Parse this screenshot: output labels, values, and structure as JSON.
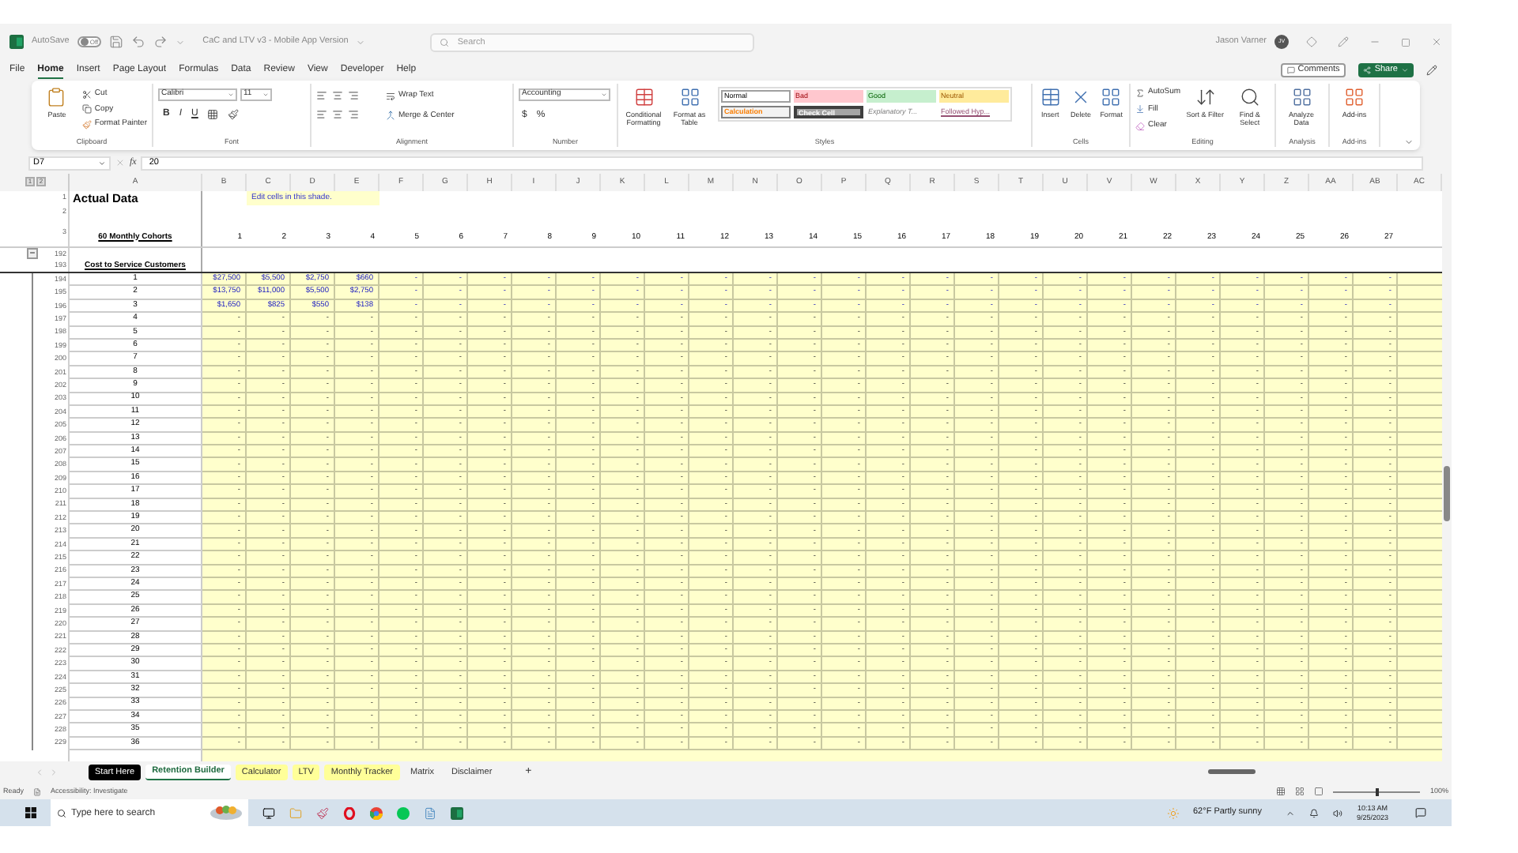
{
  "title_bar": {
    "autosave_label": "AutoSave",
    "autosave": {
      "on": false,
      "label": "Off"
    },
    "document_title": "CaC and LTV v3 - Mobile App Version",
    "search_placeholder": "Search",
    "user_name": "Jason Varner",
    "avatar_initials": "JV"
  },
  "menu_tabs": [
    {
      "label": "File",
      "selected": false
    },
    {
      "label": "Home",
      "selected": true
    },
    {
      "label": "Insert",
      "selected": false
    },
    {
      "label": "Page Layout",
      "selected": false
    },
    {
      "label": "Formulas",
      "selected": false
    },
    {
      "label": "Data",
      "selected": false
    },
    {
      "label": "Review",
      "selected": false
    },
    {
      "label": "View",
      "selected": false
    },
    {
      "label": "Developer",
      "selected": false
    },
    {
      "label": "Help",
      "selected": false
    }
  ],
  "comments_button": "Comments",
  "share_button": "Share",
  "ribbon": {
    "clipboard": {
      "paste": "Paste",
      "cut": "Cut",
      "copy": "Copy",
      "format_painter": "Format Painter",
      "group_label": "Clipboard"
    },
    "font": {
      "font_name": "Calibri",
      "font_size": "11",
      "format_buttons": [
        "B",
        "I",
        "U"
      ],
      "group_label": "Font"
    },
    "alignment": {
      "wrap_text": "Wrap Text",
      "merge_center": "Merge & Center",
      "group_label": "Alignment"
    },
    "number": {
      "format": "Accounting",
      "symbols": [
        "$",
        "%"
      ],
      "group_label": "Number"
    },
    "styles": {
      "conditional_formatting": "Conditional Formatting",
      "format_as_table": "Format as Table",
      "group_label": "Styles",
      "cell_styles": [
        {
          "label": "Normal",
          "kind": "normal"
        },
        {
          "label": "Bad",
          "kind": "bad"
        },
        {
          "label": "Good",
          "kind": "good"
        },
        {
          "label": "Neutral",
          "kind": "neutral"
        },
        {
          "label": "Calculation",
          "kind": "calculation"
        },
        {
          "label": "Check Cell",
          "kind": "check"
        },
        {
          "label": "Explanatory T...",
          "kind": "explanatory"
        },
        {
          "label": "Followed Hyp...",
          "kind": "followed"
        }
      ]
    },
    "cells": {
      "buttons": [
        "Insert",
        "Delete",
        "Format"
      ],
      "group_label": "Cells"
    },
    "editing": {
      "autosum": "AutoSum",
      "fill": "Fill",
      "clear": "Clear",
      "sort_filter": "Sort & Filter",
      "find_select": "Find & Select",
      "group_label": "Editing"
    },
    "analysis": {
      "analyze_data": "Analyze Data",
      "group_label": "Analysis"
    },
    "add_ins": {
      "button": "Add-ins",
      "group_label": "Add-ins"
    }
  },
  "formula_bar": {
    "name_box": "D7",
    "fx": "fx",
    "value": "20"
  },
  "sheet": {
    "outline_levels": [
      "1",
      "2"
    ],
    "collapse_button": "−",
    "columns": [
      "A",
      "B",
      "C",
      "D",
      "E",
      "F",
      "G",
      "H",
      "I",
      "J",
      "K",
      "L",
      "M",
      "N",
      "O",
      "P",
      "Q",
      "R",
      "S",
      "T",
      "U",
      "V",
      "W",
      "X",
      "Y",
      "Z",
      "AA",
      "AB",
      "AC"
    ],
    "title_row": {
      "number": "1",
      "title": "Actual Data",
      "note": "Edit cells in this shade."
    },
    "blank_row": {
      "number": "2"
    },
    "header_row": {
      "number": "3",
      "label": "60 Monthly Cohorts",
      "cells": [
        "1",
        "2",
        "3",
        "4",
        "5",
        "6",
        "7",
        "8",
        "9",
        "10",
        "11",
        "12",
        "13",
        "14",
        "15",
        "16",
        "17",
        "18",
        "19",
        "20",
        "21",
        "22",
        "23",
        "24",
        "25",
        "26",
        "27"
      ]
    },
    "spacer_row": {
      "number": "192"
    },
    "section_row": {
      "number": "193",
      "label": "Cost to Service Customers"
    },
    "rows": [
      {
        "number": "194",
        "label": "1",
        "cells": [
          "$27,500",
          "$5,500",
          "$2,750",
          "$660",
          "-",
          "-",
          "-",
          "-",
          "-",
          "-",
          "-",
          "-",
          "-",
          "-",
          "-",
          "-",
          "-",
          "-",
          "-",
          "-",
          "-",
          "-",
          "-",
          "-",
          "-",
          "-",
          "-"
        ]
      },
      {
        "number": "195",
        "label": "2",
        "cells": [
          "$13,750",
          "$11,000",
          "$5,500",
          "$2,750",
          "-",
          "-",
          "-",
          "-",
          "-",
          "-",
          "-",
          "-",
          "-",
          "-",
          "-",
          "-",
          "-",
          "-",
          "-",
          "-",
          "-",
          "-",
          "-",
          "-",
          "-",
          "-",
          "-"
        ]
      },
      {
        "number": "196",
        "label": "3",
        "cells": [
          "$1,650",
          "$825",
          "$550",
          "$138",
          "-",
          "-",
          "-",
          "-",
          "-",
          "-",
          "-",
          "-",
          "-",
          "-",
          "-",
          "-",
          "-",
          "-",
          "-",
          "-",
          "-",
          "-",
          "-",
          "-",
          "-",
          "-",
          "-"
        ]
      },
      {
        "number": "197",
        "label": "4",
        "cells": [
          "-",
          "-",
          "-",
          "-",
          "-",
          "-",
          "-",
          "-",
          "-",
          "-",
          "-",
          "-",
          "-",
          "-",
          "-",
          "-",
          "-",
          "-",
          "-",
          "-",
          "-",
          "-",
          "-",
          "-",
          "-",
          "-",
          "-"
        ]
      },
      {
        "number": "198",
        "label": "5",
        "cells": [
          "-",
          "-",
          "-",
          "-",
          "-",
          "-",
          "-",
          "-",
          "-",
          "-",
          "-",
          "-",
          "-",
          "-",
          "-",
          "-",
          "-",
          "-",
          "-",
          "-",
          "-",
          "-",
          "-",
          "-",
          "-",
          "-",
          "-"
        ]
      },
      {
        "number": "199",
        "label": "6",
        "cells": [
          "-",
          "-",
          "-",
          "-",
          "-",
          "-",
          "-",
          "-",
          "-",
          "-",
          "-",
          "-",
          "-",
          "-",
          "-",
          "-",
          "-",
          "-",
          "-",
          "-",
          "-",
          "-",
          "-",
          "-",
          "-",
          "-",
          "-"
        ]
      },
      {
        "number": "200",
        "label": "7",
        "cells": [
          "-",
          "-",
          "-",
          "-",
          "-",
          "-",
          "-",
          "-",
          "-",
          "-",
          "-",
          "-",
          "-",
          "-",
          "-",
          "-",
          "-",
          "-",
          "-",
          "-",
          "-",
          "-",
          "-",
          "-",
          "-",
          "-",
          "-"
        ]
      },
      {
        "number": "201",
        "label": "8",
        "cells": [
          "-",
          "-",
          "-",
          "-",
          "-",
          "-",
          "-",
          "-",
          "-",
          "-",
          "-",
          "-",
          "-",
          "-",
          "-",
          "-",
          "-",
          "-",
          "-",
          "-",
          "-",
          "-",
          "-",
          "-",
          "-",
          "-",
          "-"
        ]
      },
      {
        "number": "202",
        "label": "9",
        "cells": [
          "-",
          "-",
          "-",
          "-",
          "-",
          "-",
          "-",
          "-",
          "-",
          "-",
          "-",
          "-",
          "-",
          "-",
          "-",
          "-",
          "-",
          "-",
          "-",
          "-",
          "-",
          "-",
          "-",
          "-",
          "-",
          "-",
          "-"
        ]
      },
      {
        "number": "203",
        "label": "10",
        "cells": [
          "-",
          "-",
          "-",
          "-",
          "-",
          "-",
          "-",
          "-",
          "-",
          "-",
          "-",
          "-",
          "-",
          "-",
          "-",
          "-",
          "-",
          "-",
          "-",
          "-",
          "-",
          "-",
          "-",
          "-",
          "-",
          "-",
          "-"
        ]
      },
      {
        "number": "204",
        "label": "11",
        "cells": [
          "-",
          "-",
          "-",
          "-",
          "-",
          "-",
          "-",
          "-",
          "-",
          "-",
          "-",
          "-",
          "-",
          "-",
          "-",
          "-",
          "-",
          "-",
          "-",
          "-",
          "-",
          "-",
          "-",
          "-",
          "-",
          "-",
          "-"
        ]
      },
      {
        "number": "205",
        "label": "12",
        "cells": [
          "-",
          "-",
          "-",
          "-",
          "-",
          "-",
          "-",
          "-",
          "-",
          "-",
          "-",
          "-",
          "-",
          "-",
          "-",
          "-",
          "-",
          "-",
          "-",
          "-",
          "-",
          "-",
          "-",
          "-",
          "-",
          "-",
          "-"
        ]
      },
      {
        "number": "206",
        "label": "13",
        "cells": [
          "-",
          "-",
          "-",
          "-",
          "-",
          "-",
          "-",
          "-",
          "-",
          "-",
          "-",
          "-",
          "-",
          "-",
          "-",
          "-",
          "-",
          "-",
          "-",
          "-",
          "-",
          "-",
          "-",
          "-",
          "-",
          "-",
          "-"
        ]
      },
      {
        "number": "207",
        "label": "14",
        "cells": [
          "-",
          "-",
          "-",
          "-",
          "-",
          "-",
          "-",
          "-",
          "-",
          "-",
          "-",
          "-",
          "-",
          "-",
          "-",
          "-",
          "-",
          "-",
          "-",
          "-",
          "-",
          "-",
          "-",
          "-",
          "-",
          "-",
          "-"
        ]
      },
      {
        "number": "208",
        "label": "15",
        "cells": [
          "-",
          "-",
          "-",
          "-",
          "-",
          "-",
          "-",
          "-",
          "-",
          "-",
          "-",
          "-",
          "-",
          "-",
          "-",
          "-",
          "-",
          "-",
          "-",
          "-",
          "-",
          "-",
          "-",
          "-",
          "-",
          "-",
          "-"
        ]
      },
      {
        "number": "209",
        "label": "16",
        "cells": [
          "-",
          "-",
          "-",
          "-",
          "-",
          "-",
          "-",
          "-",
          "-",
          "-",
          "-",
          "-",
          "-",
          "-",
          "-",
          "-",
          "-",
          "-",
          "-",
          "-",
          "-",
          "-",
          "-",
          "-",
          "-",
          "-",
          "-"
        ]
      },
      {
        "number": "210",
        "label": "17",
        "cells": [
          "-",
          "-",
          "-",
          "-",
          "-",
          "-",
          "-",
          "-",
          "-",
          "-",
          "-",
          "-",
          "-",
          "-",
          "-",
          "-",
          "-",
          "-",
          "-",
          "-",
          "-",
          "-",
          "-",
          "-",
          "-",
          "-",
          "-"
        ]
      },
      {
        "number": "211",
        "label": "18",
        "cells": [
          "-",
          "-",
          "-",
          "-",
          "-",
          "-",
          "-",
          "-",
          "-",
          "-",
          "-",
          "-",
          "-",
          "-",
          "-",
          "-",
          "-",
          "-",
          "-",
          "-",
          "-",
          "-",
          "-",
          "-",
          "-",
          "-",
          "-"
        ]
      },
      {
        "number": "212",
        "label": "19",
        "cells": [
          "-",
          "-",
          "-",
          "-",
          "-",
          "-",
          "-",
          "-",
          "-",
          "-",
          "-",
          "-",
          "-",
          "-",
          "-",
          "-",
          "-",
          "-",
          "-",
          "-",
          "-",
          "-",
          "-",
          "-",
          "-",
          "-",
          "-"
        ]
      },
      {
        "number": "213",
        "label": "20",
        "cells": [
          "-",
          "-",
          "-",
          "-",
          "-",
          "-",
          "-",
          "-",
          "-",
          "-",
          "-",
          "-",
          "-",
          "-",
          "-",
          "-",
          "-",
          "-",
          "-",
          "-",
          "-",
          "-",
          "-",
          "-",
          "-",
          "-",
          "-"
        ]
      },
      {
        "number": "214",
        "label": "21",
        "cells": [
          "-",
          "-",
          "-",
          "-",
          "-",
          "-",
          "-",
          "-",
          "-",
          "-",
          "-",
          "-",
          "-",
          "-",
          "-",
          "-",
          "-",
          "-",
          "-",
          "-",
          "-",
          "-",
          "-",
          "-",
          "-",
          "-",
          "-"
        ]
      },
      {
        "number": "215",
        "label": "22",
        "cells": [
          "-",
          "-",
          "-",
          "-",
          "-",
          "-",
          "-",
          "-",
          "-",
          "-",
          "-",
          "-",
          "-",
          "-",
          "-",
          "-",
          "-",
          "-",
          "-",
          "-",
          "-",
          "-",
          "-",
          "-",
          "-",
          "-",
          "-"
        ]
      },
      {
        "number": "216",
        "label": "23",
        "cells": [
          "-",
          "-",
          "-",
          "-",
          "-",
          "-",
          "-",
          "-",
          "-",
          "-",
          "-",
          "-",
          "-",
          "-",
          "-",
          "-",
          "-",
          "-",
          "-",
          "-",
          "-",
          "-",
          "-",
          "-",
          "-",
          "-",
          "-"
        ]
      },
      {
        "number": "217",
        "label": "24",
        "cells": [
          "-",
          "-",
          "-",
          "-",
          "-",
          "-",
          "-",
          "-",
          "-",
          "-",
          "-",
          "-",
          "-",
          "-",
          "-",
          "-",
          "-",
          "-",
          "-",
          "-",
          "-",
          "-",
          "-",
          "-",
          "-",
          "-",
          "-"
        ]
      },
      {
        "number": "218",
        "label": "25",
        "cells": [
          "-",
          "-",
          "-",
          "-",
          "-",
          "-",
          "-",
          "-",
          "-",
          "-",
          "-",
          "-",
          "-",
          "-",
          "-",
          "-",
          "-",
          "-",
          "-",
          "-",
          "-",
          "-",
          "-",
          "-",
          "-",
          "-",
          "-"
        ]
      },
      {
        "number": "219",
        "label": "26",
        "cells": [
          "-",
          "-",
          "-",
          "-",
          "-",
          "-",
          "-",
          "-",
          "-",
          "-",
          "-",
          "-",
          "-",
          "-",
          "-",
          "-",
          "-",
          "-",
          "-",
          "-",
          "-",
          "-",
          "-",
          "-",
          "-",
          "-",
          "-"
        ]
      },
      {
        "number": "220",
        "label": "27",
        "cells": [
          "-",
          "-",
          "-",
          "-",
          "-",
          "-",
          "-",
          "-",
          "-",
          "-",
          "-",
          "-",
          "-",
          "-",
          "-",
          "-",
          "-",
          "-",
          "-",
          "-",
          "-",
          "-",
          "-",
          "-",
          "-",
          "-",
          "-"
        ]
      },
      {
        "number": "221",
        "label": "28",
        "cells": [
          "-",
          "-",
          "-",
          "-",
          "-",
          "-",
          "-",
          "-",
          "-",
          "-",
          "-",
          "-",
          "-",
          "-",
          "-",
          "-",
          "-",
          "-",
          "-",
          "-",
          "-",
          "-",
          "-",
          "-",
          "-",
          "-",
          "-"
        ]
      },
      {
        "number": "222",
        "label": "29",
        "cells": [
          "-",
          "-",
          "-",
          "-",
          "-",
          "-",
          "-",
          "-",
          "-",
          "-",
          "-",
          "-",
          "-",
          "-",
          "-",
          "-",
          "-",
          "-",
          "-",
          "-",
          "-",
          "-",
          "-",
          "-",
          "-",
          "-",
          "-"
        ]
      },
      {
        "number": "223",
        "label": "30",
        "cells": [
          "-",
          "-",
          "-",
          "-",
          "-",
          "-",
          "-",
          "-",
          "-",
          "-",
          "-",
          "-",
          "-",
          "-",
          "-",
          "-",
          "-",
          "-",
          "-",
          "-",
          "-",
          "-",
          "-",
          "-",
          "-",
          "-",
          "-"
        ]
      },
      {
        "number": "224",
        "label": "31",
        "cells": [
          "-",
          "-",
          "-",
          "-",
          "-",
          "-",
          "-",
          "-",
          "-",
          "-",
          "-",
          "-",
          "-",
          "-",
          "-",
          "-",
          "-",
          "-",
          "-",
          "-",
          "-",
          "-",
          "-",
          "-",
          "-",
          "-",
          "-"
        ]
      },
      {
        "number": "225",
        "label": "32",
        "cells": [
          "-",
          "-",
          "-",
          "-",
          "-",
          "-",
          "-",
          "-",
          "-",
          "-",
          "-",
          "-",
          "-",
          "-",
          "-",
          "-",
          "-",
          "-",
          "-",
          "-",
          "-",
          "-",
          "-",
          "-",
          "-",
          "-",
          "-"
        ]
      },
      {
        "number": "226",
        "label": "33",
        "cells": [
          "-",
          "-",
          "-",
          "-",
          "-",
          "-",
          "-",
          "-",
          "-",
          "-",
          "-",
          "-",
          "-",
          "-",
          "-",
          "-",
          "-",
          "-",
          "-",
          "-",
          "-",
          "-",
          "-",
          "-",
          "-",
          "-",
          "-"
        ]
      },
      {
        "number": "227",
        "label": "34",
        "cells": [
          "-",
          "-",
          "-",
          "-",
          "-",
          "-",
          "-",
          "-",
          "-",
          "-",
          "-",
          "-",
          "-",
          "-",
          "-",
          "-",
          "-",
          "-",
          "-",
          "-",
          "-",
          "-",
          "-",
          "-",
          "-",
          "-",
          "-"
        ]
      },
      {
        "number": "228",
        "label": "35",
        "cells": [
          "-",
          "-",
          "-",
          "-",
          "-",
          "-",
          "-",
          "-",
          "-",
          "-",
          "-",
          "-",
          "-",
          "-",
          "-",
          "-",
          "-",
          "-",
          "-",
          "-",
          "-",
          "-",
          "-",
          "-",
          "-",
          "-",
          "-"
        ]
      },
      {
        "number": "229",
        "label": "36",
        "cells": [
          "-",
          "-",
          "-",
          "-",
          "-",
          "-",
          "-",
          "-",
          "-",
          "-",
          "-",
          "-",
          "-",
          "-",
          "-",
          "-",
          "-",
          "-",
          "-",
          "-",
          "-",
          "-",
          "-",
          "-",
          "-",
          "-",
          "-"
        ]
      }
    ]
  },
  "sheet_tabs": [
    {
      "label": "Start Here",
      "selected": false,
      "color": "#000000"
    },
    {
      "label": "Retention Builder",
      "selected": true
    },
    {
      "label": "Calculator",
      "selected": false,
      "color": "#ffff99"
    },
    {
      "label": "LTV",
      "selected": false,
      "color": "#ffff99"
    },
    {
      "label": "Monthly Tracker",
      "selected": false,
      "color": "#ffff99"
    },
    {
      "label": "Matrix",
      "selected": false
    },
    {
      "label": "Disclaimer",
      "selected": false
    }
  ],
  "add_sheet": "+",
  "status_bar": {
    "ready": "Ready",
    "accessibility": "Accessibility: Investigate",
    "zoom_slider": {
      "level": 0.5
    },
    "zoom": "100%"
  },
  "taskbar": {
    "search_placeholder": "Type here to search",
    "weather": "62°F Partly sunny",
    "time": "10:13 AM",
    "date": "9/25/2023"
  }
}
